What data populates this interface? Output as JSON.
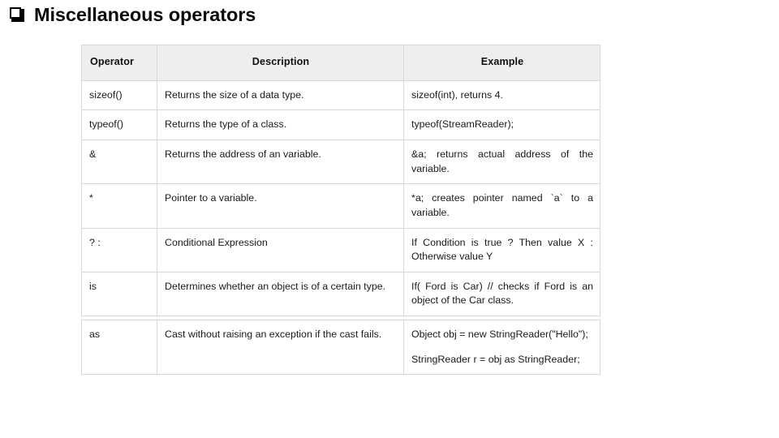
{
  "slide": {
    "bullet_icon": "hollow-square-bullet",
    "title": "Miscellaneous operators"
  },
  "table": {
    "headers": {
      "operator": "Operator",
      "description": "Description",
      "example": "Example"
    },
    "rows": [
      {
        "operator": "sizeof()",
        "description": "Returns the size of a data type.",
        "example": "sizeof(int), returns 4.",
        "justified": false
      },
      {
        "operator": "typeof()",
        "description": "Returns the type of a class.",
        "example": "typeof(StreamReader);",
        "justified": false
      },
      {
        "operator": "&",
        "description": "Returns the address of an variable.",
        "example": "&a; returns actual address of the variable.",
        "justified": true
      },
      {
        "operator": "*",
        "description": "Pointer to a variable.",
        "example": "*a; creates pointer named `a` to a variable.",
        "justified": true
      },
      {
        "operator": "? :",
        "description": "Conditional Expression",
        "example": "If Condition is true ? Then value X : Otherwise value Y",
        "justified": true
      },
      {
        "operator": "is",
        "description": "Determines whether an object is of a certain type.",
        "example": "If( Ford is Car) // checks if Ford is an object of the Car class.",
        "justified": true
      }
    ],
    "last_row": {
      "operator": "as",
      "description": "Cast without raising an exception if the cast fails.",
      "example_line_1": "Object obj = new StringReader(\"Hello\");",
      "example_line_2": "StringReader r = obj as StringReader;",
      "justified": true
    }
  },
  "colors": {
    "header_background": "#eeeeee",
    "border": "#d8d8d8",
    "text": "#1a1a1a",
    "page_background": "#ffffff"
  }
}
